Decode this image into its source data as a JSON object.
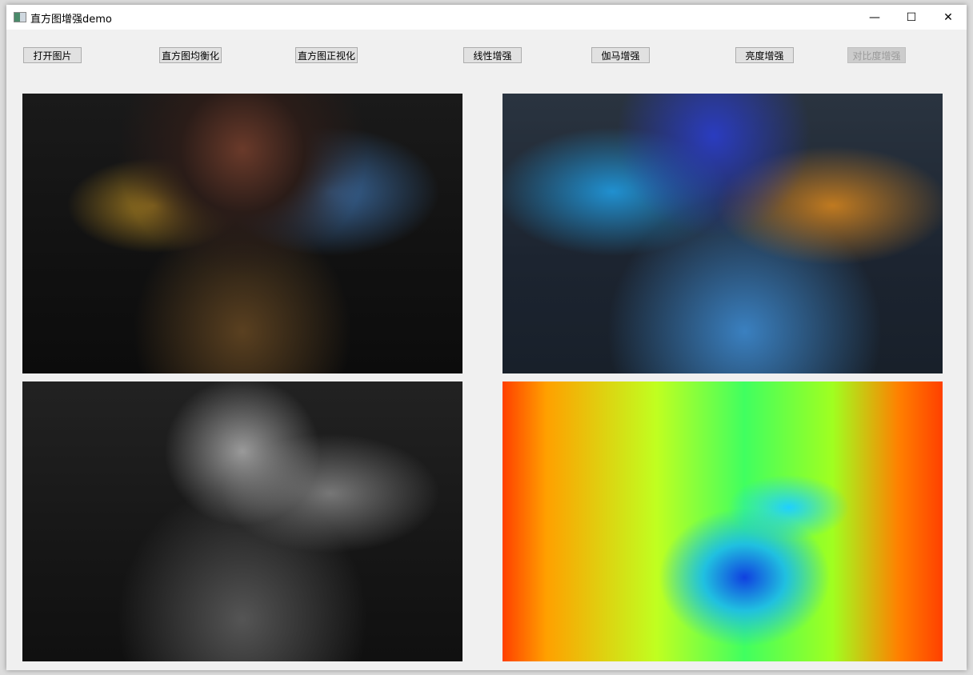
{
  "window": {
    "title": "直方图增强demo",
    "controls": {
      "minimize": "—",
      "maximize": "☐",
      "close": "✕"
    }
  },
  "toolbar": {
    "buttons": [
      {
        "label": "打开图片",
        "enabled": true
      },
      {
        "label": "直方图均衡化",
        "enabled": true
      },
      {
        "label": "直方图正视化",
        "enabled": true
      },
      {
        "label": "线性增强",
        "enabled": true
      },
      {
        "label": "伽马增强",
        "enabled": true
      },
      {
        "label": "亮度增强",
        "enabled": true
      },
      {
        "label": "对比度增强",
        "enabled": false
      }
    ]
  },
  "images": [
    {
      "name": "original-image"
    },
    {
      "name": "enhanced-color-image"
    },
    {
      "name": "grayscale-image"
    },
    {
      "name": "false-color-image"
    }
  ]
}
